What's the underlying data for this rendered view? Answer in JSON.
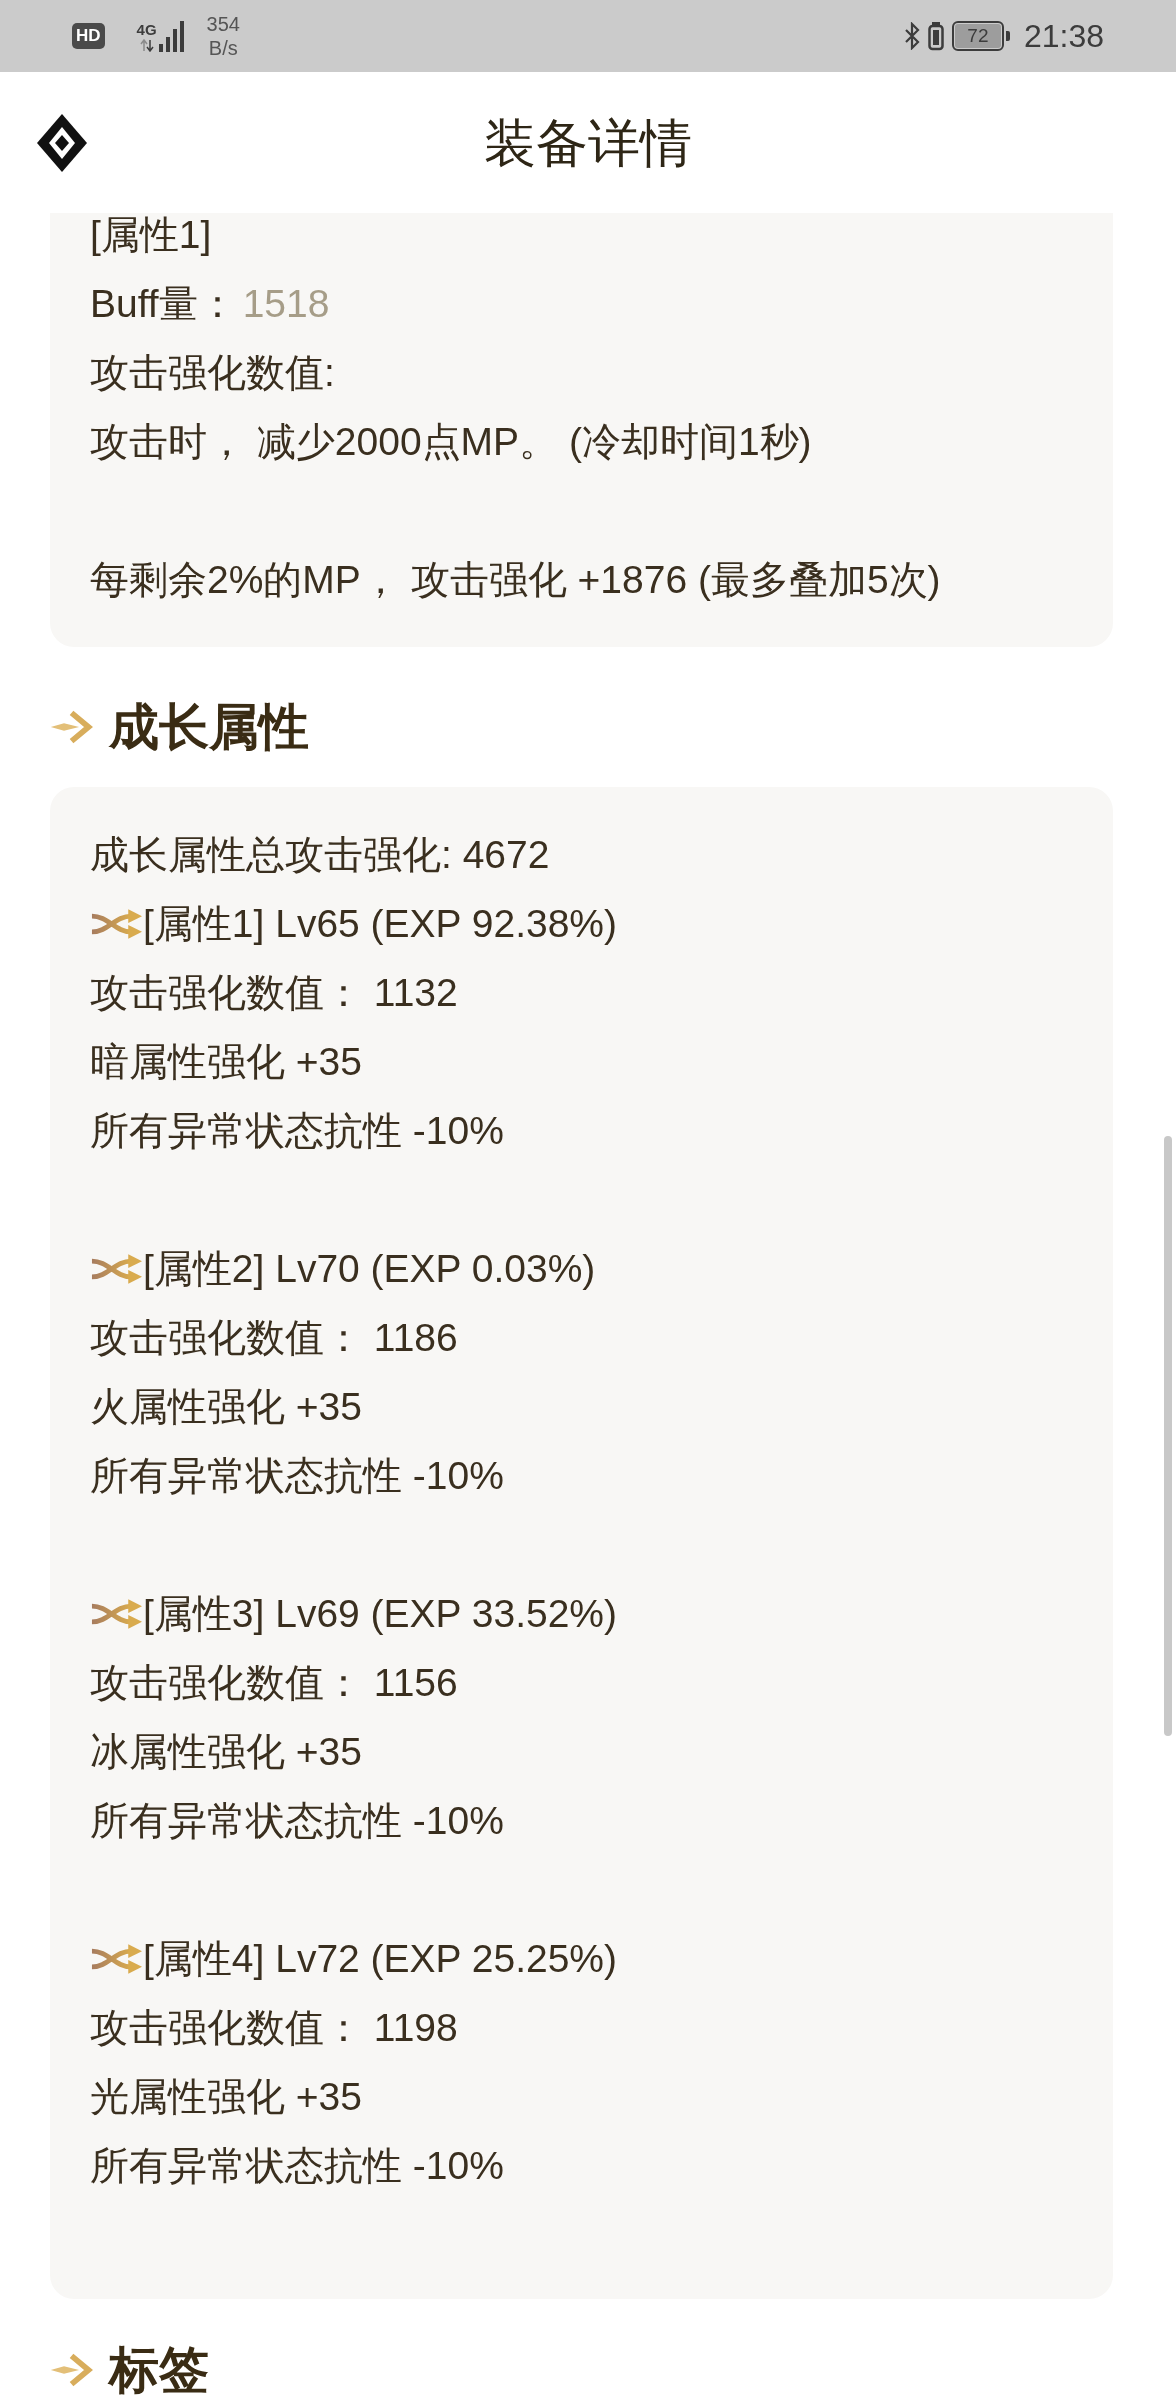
{
  "status_bar": {
    "hd": "HD",
    "network_type": "4G",
    "speed": "354",
    "speed_unit": "B/s",
    "battery": "72",
    "time": "21:38"
  },
  "header": {
    "title": "装备详情"
  },
  "attribute_card": {
    "title": "[属性1]",
    "buff": {
      "label": "Buff量：",
      "value": "1518"
    },
    "description_label": "攻击强化数值:",
    "paragraphs": [
      "攻击时， 减少2000点MP。 (冷却时间1秒)",
      "每剩余2%的MP， 攻击强化 +1876 (最多叠加5次)"
    ]
  },
  "growth_section": {
    "heading": "成长属性",
    "total": "成长属性总攻击强化: 4672",
    "attributes": [
      {
        "title": "[属性1] Lv65 (EXP 92.38%)",
        "lines": [
          "攻击强化数值： 1132",
          "暗属性强化 +35",
          "所有异常状态抗性 -10%"
        ]
      },
      {
        "title": "[属性2] Lv70 (EXP 0.03%)",
        "lines": [
          "攻击强化数值： 1186",
          "火属性强化 +35",
          "所有异常状态抗性 -10%"
        ]
      },
      {
        "title": "[属性3] Lv69 (EXP 33.52%)",
        "lines": [
          "攻击强化数值： 1156",
          "冰属性强化 +35",
          "所有异常状态抗性 -10%"
        ]
      },
      {
        "title": "[属性4] Lv72 (EXP 25.25%)",
        "lines": [
          "攻击强化数值： 1198",
          "光属性强化 +35",
          "所有异常状态抗性 -10%"
        ]
      }
    ]
  },
  "tags_section": {
    "heading": "标签"
  }
}
